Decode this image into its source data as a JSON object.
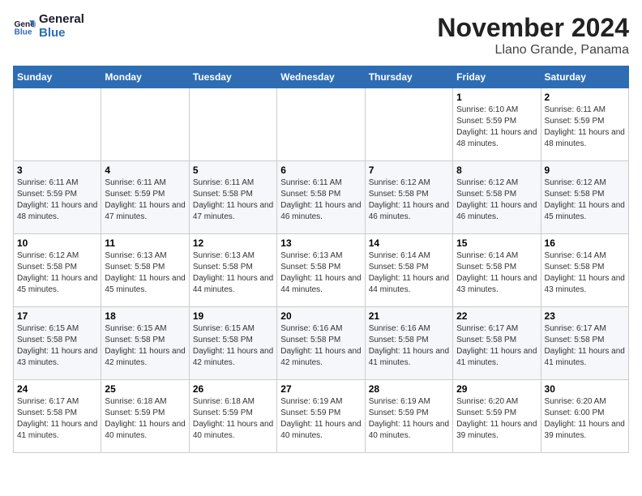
{
  "logo": {
    "line1": "General",
    "line2": "Blue"
  },
  "title": "November 2024",
  "subtitle": "Llano Grande, Panama",
  "weekdays": [
    "Sunday",
    "Monday",
    "Tuesday",
    "Wednesday",
    "Thursday",
    "Friday",
    "Saturday"
  ],
  "weeks": [
    [
      {
        "day": "",
        "info": ""
      },
      {
        "day": "",
        "info": ""
      },
      {
        "day": "",
        "info": ""
      },
      {
        "day": "",
        "info": ""
      },
      {
        "day": "",
        "info": ""
      },
      {
        "day": "1",
        "info": "Sunrise: 6:10 AM\nSunset: 5:59 PM\nDaylight: 11 hours and 48 minutes."
      },
      {
        "day": "2",
        "info": "Sunrise: 6:11 AM\nSunset: 5:59 PM\nDaylight: 11 hours and 48 minutes."
      }
    ],
    [
      {
        "day": "3",
        "info": "Sunrise: 6:11 AM\nSunset: 5:59 PM\nDaylight: 11 hours and 48 minutes."
      },
      {
        "day": "4",
        "info": "Sunrise: 6:11 AM\nSunset: 5:59 PM\nDaylight: 11 hours and 47 minutes."
      },
      {
        "day": "5",
        "info": "Sunrise: 6:11 AM\nSunset: 5:58 PM\nDaylight: 11 hours and 47 minutes."
      },
      {
        "day": "6",
        "info": "Sunrise: 6:11 AM\nSunset: 5:58 PM\nDaylight: 11 hours and 46 minutes."
      },
      {
        "day": "7",
        "info": "Sunrise: 6:12 AM\nSunset: 5:58 PM\nDaylight: 11 hours and 46 minutes."
      },
      {
        "day": "8",
        "info": "Sunrise: 6:12 AM\nSunset: 5:58 PM\nDaylight: 11 hours and 46 minutes."
      },
      {
        "day": "9",
        "info": "Sunrise: 6:12 AM\nSunset: 5:58 PM\nDaylight: 11 hours and 45 minutes."
      }
    ],
    [
      {
        "day": "10",
        "info": "Sunrise: 6:12 AM\nSunset: 5:58 PM\nDaylight: 11 hours and 45 minutes."
      },
      {
        "day": "11",
        "info": "Sunrise: 6:13 AM\nSunset: 5:58 PM\nDaylight: 11 hours and 45 minutes."
      },
      {
        "day": "12",
        "info": "Sunrise: 6:13 AM\nSunset: 5:58 PM\nDaylight: 11 hours and 44 minutes."
      },
      {
        "day": "13",
        "info": "Sunrise: 6:13 AM\nSunset: 5:58 PM\nDaylight: 11 hours and 44 minutes."
      },
      {
        "day": "14",
        "info": "Sunrise: 6:14 AM\nSunset: 5:58 PM\nDaylight: 11 hours and 44 minutes."
      },
      {
        "day": "15",
        "info": "Sunrise: 6:14 AM\nSunset: 5:58 PM\nDaylight: 11 hours and 43 minutes."
      },
      {
        "day": "16",
        "info": "Sunrise: 6:14 AM\nSunset: 5:58 PM\nDaylight: 11 hours and 43 minutes."
      }
    ],
    [
      {
        "day": "17",
        "info": "Sunrise: 6:15 AM\nSunset: 5:58 PM\nDaylight: 11 hours and 43 minutes."
      },
      {
        "day": "18",
        "info": "Sunrise: 6:15 AM\nSunset: 5:58 PM\nDaylight: 11 hours and 42 minutes."
      },
      {
        "day": "19",
        "info": "Sunrise: 6:15 AM\nSunset: 5:58 PM\nDaylight: 11 hours and 42 minutes."
      },
      {
        "day": "20",
        "info": "Sunrise: 6:16 AM\nSunset: 5:58 PM\nDaylight: 11 hours and 42 minutes."
      },
      {
        "day": "21",
        "info": "Sunrise: 6:16 AM\nSunset: 5:58 PM\nDaylight: 11 hours and 41 minutes."
      },
      {
        "day": "22",
        "info": "Sunrise: 6:17 AM\nSunset: 5:58 PM\nDaylight: 11 hours and 41 minutes."
      },
      {
        "day": "23",
        "info": "Sunrise: 6:17 AM\nSunset: 5:58 PM\nDaylight: 11 hours and 41 minutes."
      }
    ],
    [
      {
        "day": "24",
        "info": "Sunrise: 6:17 AM\nSunset: 5:58 PM\nDaylight: 11 hours and 41 minutes."
      },
      {
        "day": "25",
        "info": "Sunrise: 6:18 AM\nSunset: 5:59 PM\nDaylight: 11 hours and 40 minutes."
      },
      {
        "day": "26",
        "info": "Sunrise: 6:18 AM\nSunset: 5:59 PM\nDaylight: 11 hours and 40 minutes."
      },
      {
        "day": "27",
        "info": "Sunrise: 6:19 AM\nSunset: 5:59 PM\nDaylight: 11 hours and 40 minutes."
      },
      {
        "day": "28",
        "info": "Sunrise: 6:19 AM\nSunset: 5:59 PM\nDaylight: 11 hours and 40 minutes."
      },
      {
        "day": "29",
        "info": "Sunrise: 6:20 AM\nSunset: 5:59 PM\nDaylight: 11 hours and 39 minutes."
      },
      {
        "day": "30",
        "info": "Sunrise: 6:20 AM\nSunset: 6:00 PM\nDaylight: 11 hours and 39 minutes."
      }
    ]
  ]
}
